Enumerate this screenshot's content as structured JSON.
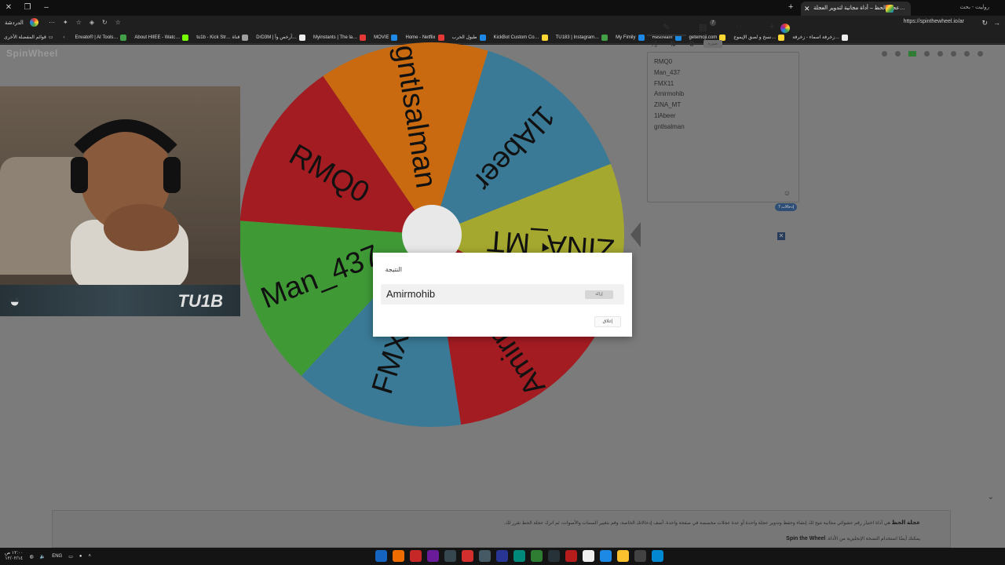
{
  "browser": {
    "active_tab_title": "عجلة الحظ – أداة مجانية لتدوير العجلة…",
    "inactive_tab_title": "روليت - بحث",
    "url": "https://spinthewheel.io/ar",
    "left_label": "الدردشة",
    "bookmarks": [
      {
        "label": "Envato® | AI Tools…",
        "color": "#43a047"
      },
      {
        "label": "About HIIEE - Watc…",
        "color": "#76ff03"
      },
      {
        "label": "tu1b - Kick Str… قناة",
        "color": "#9e9e9e"
      },
      {
        "label": "DrD3M | آرخص وأ…",
        "color": "#eeeeee"
      },
      {
        "label": "Myinstants | The la…",
        "color": "#e53935"
      },
      {
        "label": "MOVIE",
        "color": "#1e88e5"
      },
      {
        "label": "Home - Netflix",
        "color": "#e53935"
      },
      {
        "label": "طبول الحرب",
        "color": "#1e88e5"
      },
      {
        "label": "KickBot Custom Co…",
        "color": "#fdd835"
      },
      {
        "label": "TU183 | Instagram…",
        "color": "#43a047"
      },
      {
        "label": "My Fimily",
        "color": "#1e88e5"
      },
      {
        "label": "Restream",
        "color": "#1e88e5"
      },
      {
        "label": "getemoji.com",
        "color": "#fdd835"
      },
      {
        "label": "نسخ و لصق الإيموج…",
        "color": "#fdd835"
      },
      {
        "label": "زخرفة اسماء - زخرفة…",
        "color": "#eeeeee"
      }
    ],
    "bookmarks_folder": "قوائم المفضلة الأخرى"
  },
  "site": {
    "logo": "SpinWheel"
  },
  "wheel": {
    "segments": [
      {
        "label": "1lAbeer",
        "color": "#3a7a96"
      },
      {
        "label": "ZINA_MT",
        "color": "#a5a82f"
      },
      {
        "label": "Amirmohib",
        "color": "#a31c22"
      },
      {
        "label": "FMX11",
        "color": "#3a7a96"
      },
      {
        "label": "Man_437",
        "color": "#3f9a36"
      },
      {
        "label": "RMQ0",
        "color": "#a31c22"
      },
      {
        "label": "gntlsalman",
        "color": "#c96a10"
      }
    ]
  },
  "webcam": {
    "banner_text": "TU1B"
  },
  "panel": {
    "tools": {
      "shuffle": "⤮",
      "sort": "⇅",
      "settings": "⚙",
      "add_image": "صورة"
    },
    "entries": [
      "RMQ0",
      "Man_437",
      "FMX11",
      "Amirmohib",
      "ZINA_MT",
      "1lAbeer",
      "gntlsalman"
    ],
    "entries_count": "إدخالات 7",
    "badge_count": "7"
  },
  "dialog": {
    "title": "النتيجة",
    "winner": "Amirmohib",
    "remove_label": "إزالة",
    "close_label": "إغلاق"
  },
  "info": {
    "line1_bold": "عجلة الحظ",
    "line1": "هي أداة اختيار رقم عشوائي مجانية تتيح لك إنشاء وحفظ وتدوير عجلة واحدة أو عدة عجلات مخصصة في صفحة واحدة. أضف إدخالاتك الخاصة، وقم بتغيير السمات والأصوات، ثم اترك عجلة الحظ تقرر لك.",
    "line2_bold": "Spin the Wheel",
    "line2": "يمكنك أيضًا استخدام النسخة الإنجليزية من الأداة."
  },
  "taskbar": {
    "time": "١٢:٠٠ ص",
    "date": "١٢/٠٢/١٤",
    "lang": "ENG"
  }
}
